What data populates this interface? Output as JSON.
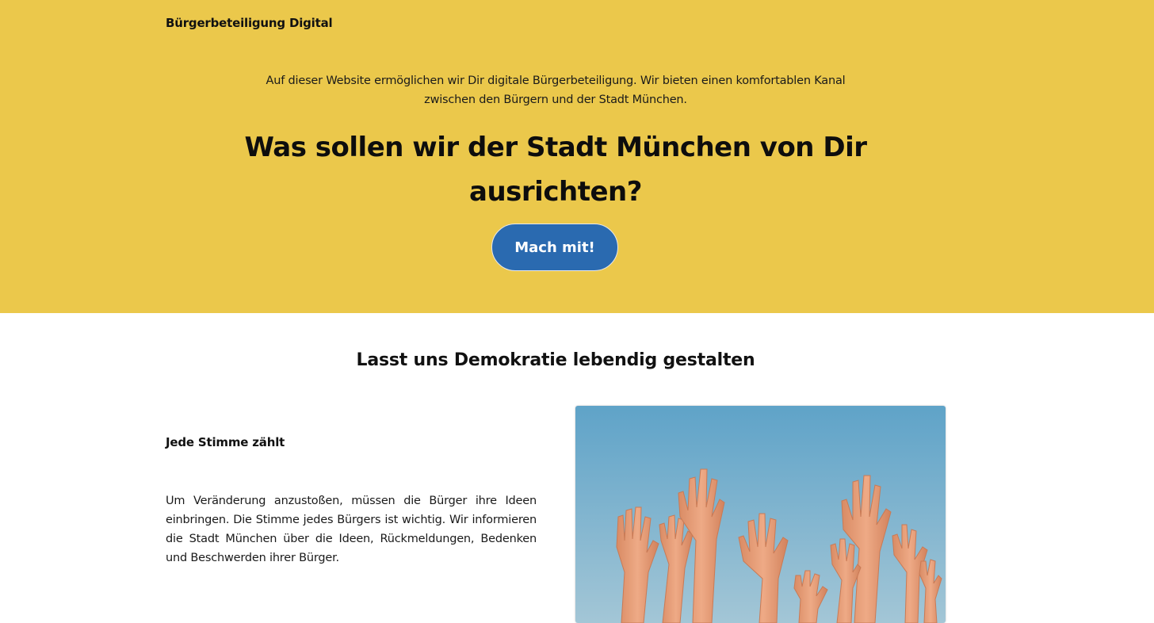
{
  "header": {
    "brand": "Bürgerbeteiligung Digital"
  },
  "hero": {
    "intro": "Auf dieser Website ermöglichen wir Dir digitale Bürgerbeteiligung. Wir bieten einen komfortablen Kanal zwischen den Bürgern und der Stadt München.",
    "headline": "Was sollen wir der Stadt München von Dir ausrichten?",
    "cta_label": "Mach mit!"
  },
  "section": {
    "title": "Lasst uns Demokratie lebendig gestalten",
    "feature_title": "Jede Stimme zählt",
    "feature_text": "Um Veränderung anzustoßen, müssen die Bürger ihre Ideen einbringen. Die Stimme jedes Bürgers ist wichtig. Wir informieren die Stadt München über die Ideen, Rückmeldungen, Bedenken und Beschwerden ihrer Bürger."
  },
  "colors": {
    "hero_background": "#ebc84b",
    "cta_background": "#2a6ab0",
    "sky_top": "#5fa3c8",
    "sky_bottom": "#9cc3d6",
    "skin": "#e7a07c"
  }
}
